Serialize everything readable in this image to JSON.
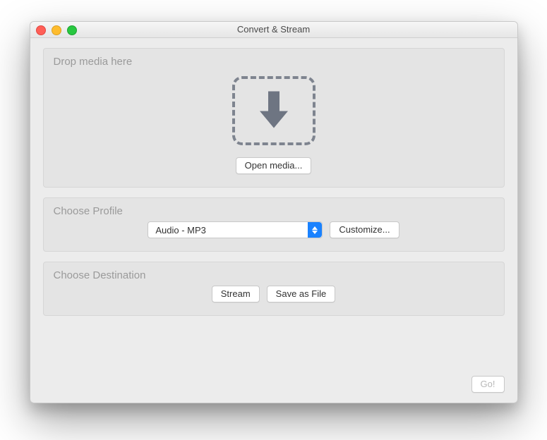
{
  "window": {
    "title": "Convert & Stream"
  },
  "media": {
    "title": "Drop media here",
    "open_button": "Open media..."
  },
  "profile": {
    "title": "Choose Profile",
    "selected": "Audio - MP3",
    "customize_button": "Customize..."
  },
  "destination": {
    "title": "Choose Destination",
    "stream_button": "Stream",
    "save_button": "Save as File"
  },
  "footer": {
    "go_button": "Go!"
  }
}
